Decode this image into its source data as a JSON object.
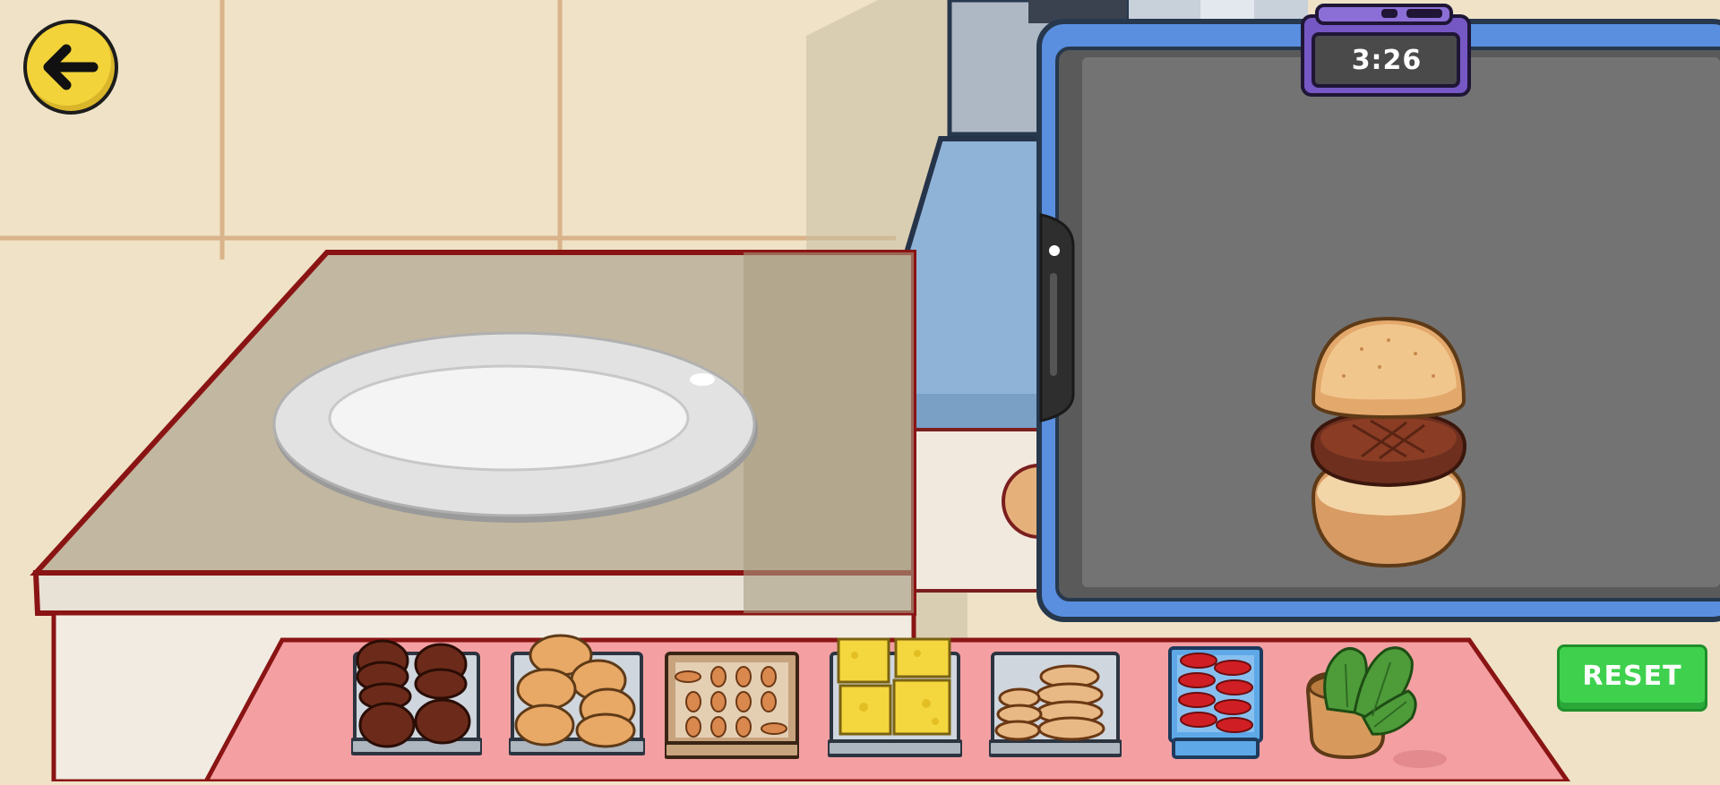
{
  "header": {
    "back_icon": "arrow-left-icon"
  },
  "timer": {
    "time": "3:26",
    "color": "#6a4fb3"
  },
  "grill": {
    "burger_layers": [
      "top-bun",
      "beef-patty",
      "bottom-bun"
    ]
  },
  "ingredients": [
    {
      "name": "beef-patties",
      "icon": "patty-icon"
    },
    {
      "name": "buns",
      "icon": "bun-icon"
    },
    {
      "name": "chicken-eggs",
      "icon": "egg-icon"
    },
    {
      "name": "cheese-slices",
      "icon": "cheese-icon"
    },
    {
      "name": "bun-bottoms",
      "icon": "flat-bun-icon"
    },
    {
      "name": "tomato-slices",
      "icon": "tomato-icon"
    },
    {
      "name": "lettuce",
      "icon": "lettuce-icon"
    }
  ],
  "controls": {
    "reset_label": "RESET",
    "reset_color": "#3fd14e"
  },
  "colors": {
    "counter": "#f4a0a3",
    "grill_frame": "#5a8fe0",
    "grill_surface": "#737373",
    "back_button": "#f3d33a"
  }
}
